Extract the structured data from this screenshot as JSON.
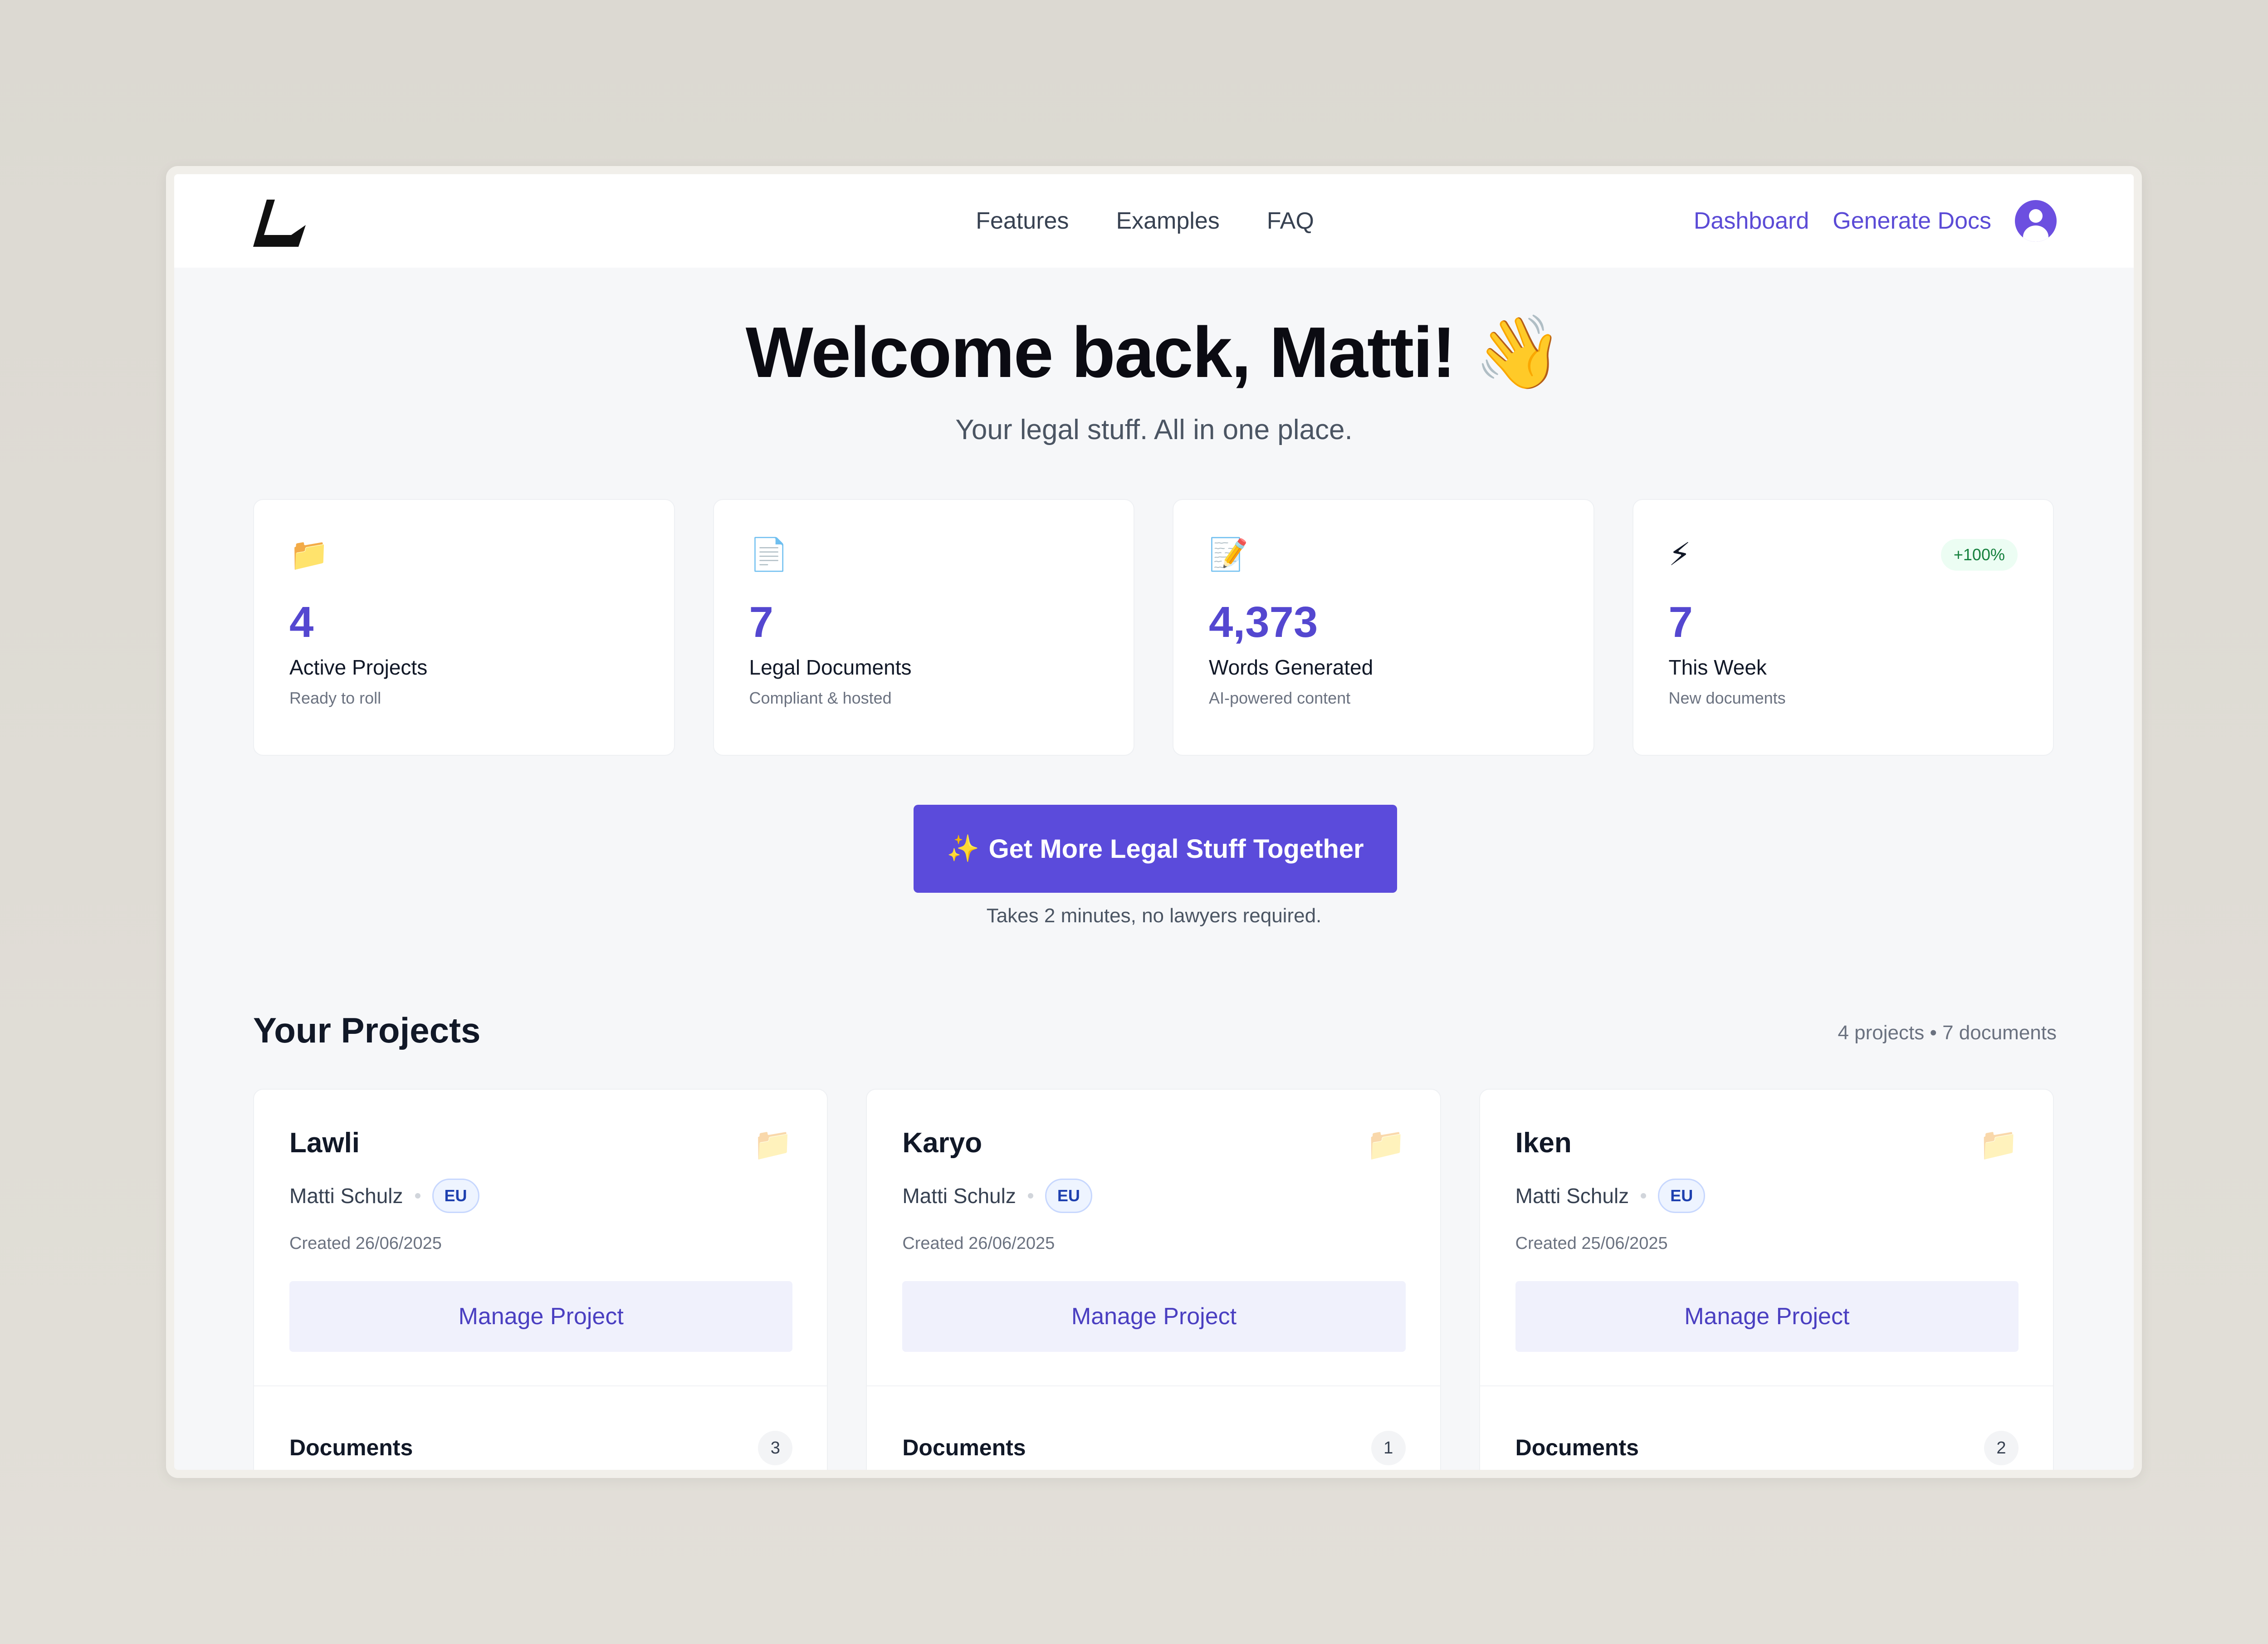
{
  "nav": {
    "links": [
      "Features",
      "Examples",
      "FAQ"
    ],
    "right": {
      "dashboard": "Dashboard",
      "generate_docs": "Generate Docs"
    }
  },
  "hero": {
    "title": "Welcome back, Matti! 👋",
    "subtitle": "Your legal stuff. All in one place."
  },
  "stats": [
    {
      "icon": "📁",
      "icon_name": "folder-icon",
      "value": "4",
      "label": "Active Projects",
      "sub": "Ready to roll",
      "badge": ""
    },
    {
      "icon": "📄",
      "icon_name": "document-icon",
      "value": "7",
      "label": "Legal Documents",
      "sub": "Compliant & hosted",
      "badge": ""
    },
    {
      "icon": "📝",
      "icon_name": "memo-icon",
      "value": "4,373",
      "label": "Words Generated",
      "sub": "AI-powered content",
      "badge": ""
    },
    {
      "icon": "⚡",
      "icon_name": "lightning-icon",
      "value": "7",
      "label": "This Week",
      "sub": "New documents",
      "badge": "+100%"
    }
  ],
  "cta": {
    "icon": "✨",
    "label": "Get More Legal Stuff Together",
    "note": "Takes 2 minutes, no lawyers required."
  },
  "projects_section": {
    "title": "Your Projects",
    "summary": "4 projects • 7 documents"
  },
  "projects": [
    {
      "name": "Lawli",
      "owner": "Matti Schulz",
      "region": "EU",
      "created": "Created 26/06/2025",
      "manage_label": "Manage Project",
      "documents_label": "Documents",
      "documents_count": "3"
    },
    {
      "name": "Karyo",
      "owner": "Matti Schulz",
      "region": "EU",
      "created": "Created 26/06/2025",
      "manage_label": "Manage Project",
      "documents_label": "Documents",
      "documents_count": "1"
    },
    {
      "name": "Iken",
      "owner": "Matti Schulz",
      "region": "EU",
      "created": "Created 25/06/2025",
      "manage_label": "Manage Project",
      "documents_label": "Documents",
      "documents_count": "2"
    }
  ],
  "colors": {
    "accent": "#5b4bdb",
    "stat_value": "#5447d0",
    "badge_green": "#15803d"
  }
}
